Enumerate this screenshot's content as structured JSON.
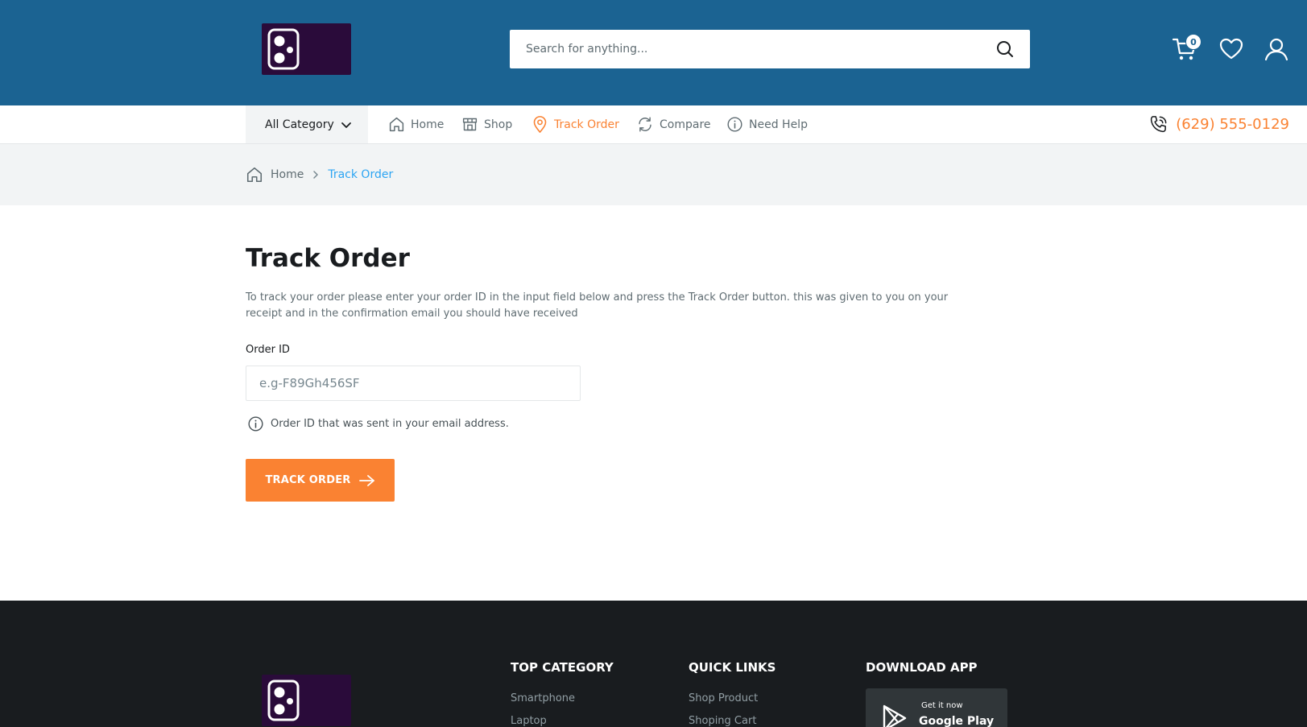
{
  "header": {
    "search_placeholder": "Search for anything...",
    "cart_count": "0"
  },
  "nav": {
    "all_category": "All Category",
    "items": [
      {
        "label": "Home"
      },
      {
        "label": "Shop"
      },
      {
        "label": "Track Order"
      },
      {
        "label": "Compare"
      },
      {
        "label": "Need Help"
      }
    ],
    "phone": "(629) 555-0129",
    "active": "Track Order"
  },
  "breadcrumb": {
    "home": "Home",
    "current": "Track Order"
  },
  "main": {
    "title": "Track Order",
    "description": "To track your order please enter your order ID in the input field below and press the Track Order button. this was given to you on your receipt and in the confirmation email you should have received",
    "order_label": "Order ID",
    "order_placeholder": "e.g-F89Gh456SF",
    "hint": "Order ID that was sent in your email address.",
    "button_label": "TRACK ORDER"
  },
  "footer": {
    "top_category": {
      "heading": "TOP CATEGORY",
      "links": [
        "Smartphone",
        "Laptop"
      ]
    },
    "quick_links": {
      "heading": "QUICK LINKS",
      "links": [
        "Shop Product",
        "Shoping Cart"
      ]
    },
    "download_app": {
      "heading": "DOWNLOAD APP",
      "small_text": "Get it now",
      "store": "Google Play"
    }
  },
  "colors": {
    "header_bg": "#1b6392",
    "accent": "#fa8232",
    "link": "#2da5f3",
    "footer_bg": "#191c1f",
    "logo_bg": "#2a0b3a"
  }
}
